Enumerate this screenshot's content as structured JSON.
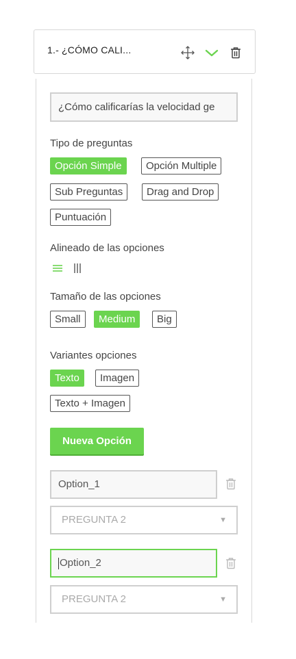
{
  "header": {
    "title": "1.- ¿CÓMO CALI...",
    "icons": [
      "move-icon",
      "chevron-down-icon",
      "trash-icon"
    ]
  },
  "question": {
    "value": "¿Cómo calificarías la velocidad ge"
  },
  "question_type": {
    "label": "Tipo de preguntas",
    "options": [
      "Opción Simple",
      "Opción Multiple",
      "Sub Preguntas",
      "Drag and Drop",
      "Puntuación"
    ],
    "selected": "Opción Simple"
  },
  "alignment": {
    "label": "Alineado de las opciones",
    "options": [
      "horizontal-lines-icon",
      "vertical-lines-icon"
    ],
    "selected": "horizontal-lines-icon"
  },
  "size": {
    "label": "Tamaño de las opciones",
    "options": [
      "Small",
      "Medium",
      "Big"
    ],
    "selected": "Medium"
  },
  "variants": {
    "label": "Variantes opciones",
    "options": [
      "Texto",
      "Imagen",
      "Texto + Imagen"
    ],
    "selected": "Texto"
  },
  "new_option_button": "Nueva Opción",
  "answer_options": [
    {
      "value": "Option_1",
      "select": "PREGUNTA 2"
    },
    {
      "value": "Option_2",
      "select": "PREGUNTA 2"
    }
  ],
  "colors": {
    "accent": "#6bd44f",
    "border": "#cfcfcf",
    "text": "#444444"
  }
}
